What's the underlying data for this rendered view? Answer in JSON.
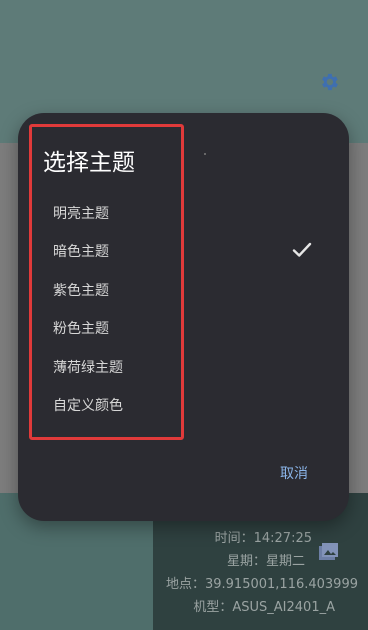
{
  "dialog": {
    "title": "选择主题",
    "options": [
      {
        "label": "明亮主题",
        "selected": false
      },
      {
        "label": "暗色主题",
        "selected": true
      },
      {
        "label": "紫色主题",
        "selected": false
      },
      {
        "label": "粉色主题",
        "selected": false
      },
      {
        "label": "薄荷绿主题",
        "selected": false
      },
      {
        "label": "自定义颜色",
        "selected": false
      }
    ],
    "cancel_label": "取消"
  },
  "info": {
    "time": "时间：14:27:25",
    "weekday": "星期：星期二",
    "location": "地点：39.915001,116.403999",
    "model": "机型：ASUS_AI2401_A"
  },
  "icons": {
    "settings": "gear-icon",
    "image": "image-icon",
    "check": "check-icon"
  },
  "colors": {
    "dialog_bg": "#2b2b31",
    "accent": "#8ab4e8",
    "highlight": "#e03a3a",
    "top_band": "#5e7b78"
  }
}
